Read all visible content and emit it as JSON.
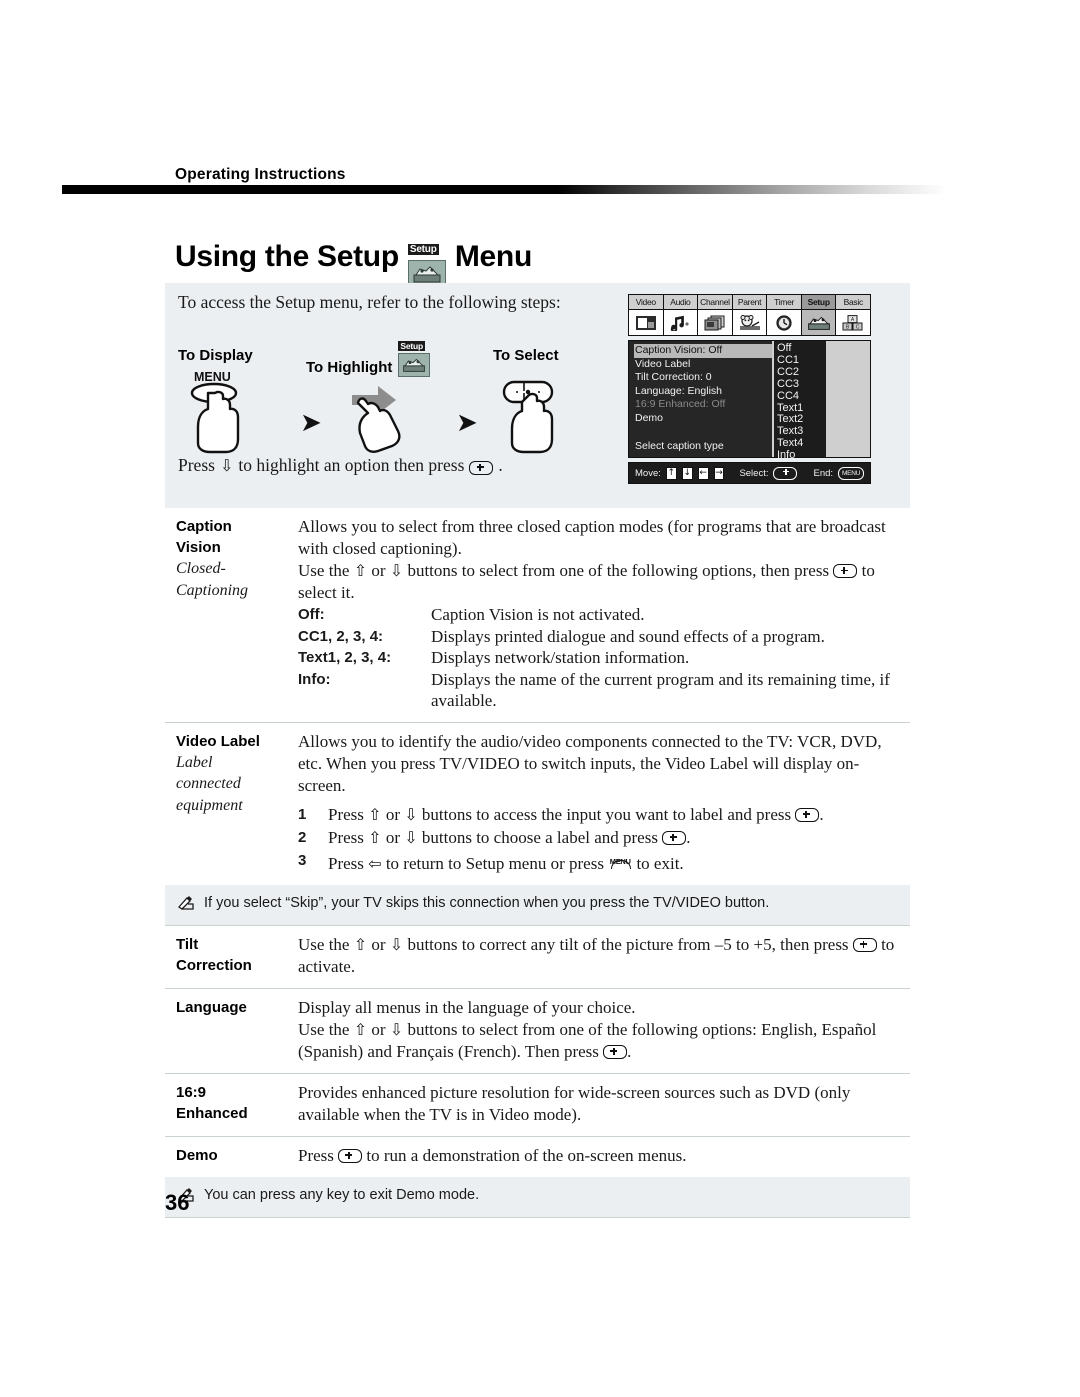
{
  "header": {
    "running_head": "Operating Instructions"
  },
  "title": {
    "before": "Using the Setup",
    "icon_label": "Setup",
    "icon_name": "setup-menu-icon",
    "after": "Menu"
  },
  "intro_panel": {
    "lead": "To access the Setup menu, refer to the following steps:",
    "steps": [
      {
        "label": "To Display",
        "key_label": "MENU",
        "icon": "menu-button-hand"
      },
      {
        "label": "To Highlight",
        "icon_label": "Setup",
        "icon": "arrow-hand"
      },
      {
        "label": "To Select",
        "icon": "select-button-hand"
      }
    ],
    "closing_before": "Press",
    "closing_mid": "to highlight an option then press",
    "closing_after": "."
  },
  "osd": {
    "menu_tabs": [
      {
        "label": "Video",
        "icon": "video-icon",
        "selected": false
      },
      {
        "label": "Audio",
        "icon": "audio-icon",
        "selected": false
      },
      {
        "label": "Channel",
        "icon": "channel-icon",
        "selected": false
      },
      {
        "label": "Parent",
        "icon": "parent-icon",
        "selected": false
      },
      {
        "label": "Timer",
        "icon": "timer-icon",
        "selected": false
      },
      {
        "label": "Setup",
        "icon": "setup-icon",
        "selected": true
      },
      {
        "label": "Basic",
        "icon": "basic-icon",
        "selected": false
      }
    ],
    "menu_items": [
      {
        "text": "Caption Vision: Off",
        "state": "highlighted"
      },
      {
        "text": "Video Label",
        "state": "normal"
      },
      {
        "text": "Tilt Correction: 0",
        "state": "normal"
      },
      {
        "text": "Language: English",
        "state": "normal"
      },
      {
        "text": "16:9 Enhanced: Off",
        "state": "disabled"
      },
      {
        "text": "Demo",
        "state": "normal"
      }
    ],
    "hint": "Select caption type",
    "options": [
      "Off",
      "CC1",
      "CC2",
      "CC3",
      "CC4",
      "Text1",
      "Text2",
      "Text3",
      "Text4",
      "Info"
    ],
    "footer": {
      "move_label": "Move:",
      "move_keys": [
        "↑",
        "↓",
        "←",
        "→"
      ],
      "select_label": "Select:",
      "end_label": "End:",
      "end_key": "MENU"
    }
  },
  "sections": [
    {
      "term": "Caption Vision",
      "term_l1": "Caption",
      "term_l2": "Vision",
      "subterm_l1": "Closed-",
      "subterm_l2": "Captioning",
      "para1": "Allows you to select from three closed caption modes (for programs that are broadcast with closed captioning).",
      "para2_a": "Use the",
      "para2_b": "or",
      "para2_c": "buttons to select from one of the following options, then press",
      "para2_d": "to select it.",
      "options": [
        {
          "key": "Off:",
          "desc": "Caption Vision is not activated."
        },
        {
          "key": "CC1, 2, 3, 4:",
          "desc": "Displays printed dialogue and sound effects of a program."
        },
        {
          "key": "Text1, 2, 3, 4:",
          "desc": "Displays network/station information."
        },
        {
          "key": "Info:",
          "desc": "Displays the name of the current program and its remaining time, if available."
        }
      ]
    },
    {
      "term": "Video Label",
      "subterm_l1": "Label",
      "subterm_l2": "connected",
      "subterm_l3": "equipment",
      "para1": "Allows you to identify the audio/video components connected to the TV: VCR, DVD, etc. When you press TV/VIDEO to switch inputs, the Video Label will display on-screen.",
      "steps": [
        {
          "n": "1",
          "a": "Press",
          "b": "or",
          "c": "buttons to access the input you want to label and press",
          "d": "."
        },
        {
          "n": "2",
          "a": "Press",
          "b": "or",
          "c": "buttons to choose a label and press",
          "d": "."
        },
        {
          "n": "3",
          "a": "Press",
          "b": "to return to Setup menu or press",
          "c": "to exit."
        }
      ],
      "note": "If you select “Skip”, your TV skips this connection when you press the TV/VIDEO button."
    },
    {
      "term_l1": "Tilt",
      "term_l2": "Correction",
      "para_a": "Use the",
      "para_b": "or",
      "para_c": "buttons to correct any tilt of the picture from –5 to +5, then press",
      "para_d": "to activate."
    },
    {
      "term": "Language",
      "para1": "Display all menus in the language of your choice.",
      "para2_a": "Use the",
      "para2_b": "or",
      "para2_c": "buttons to select from one of the following options: English, Español (Spanish) and Français (French). Then press",
      "para2_d": "."
    },
    {
      "term_l1": "16:9",
      "term_l2": "Enhanced",
      "para1": "Provides enhanced picture resolution for wide-screen sources such as DVD (only available when the TV is in Video mode)."
    },
    {
      "term": "Demo",
      "para_a": "Press",
      "para_b": "to run a demonstration of the on-screen menus.",
      "note": "You can press any key to exit Demo mode."
    }
  ],
  "footer": {
    "page_number": "36"
  },
  "colors": {
    "panel_bg": "#eceff1",
    "rule_dark": "#000000",
    "icon_green": "#9fb3ad",
    "osd_bg": "#262626",
    "highlight": "#b9b9b9"
  }
}
